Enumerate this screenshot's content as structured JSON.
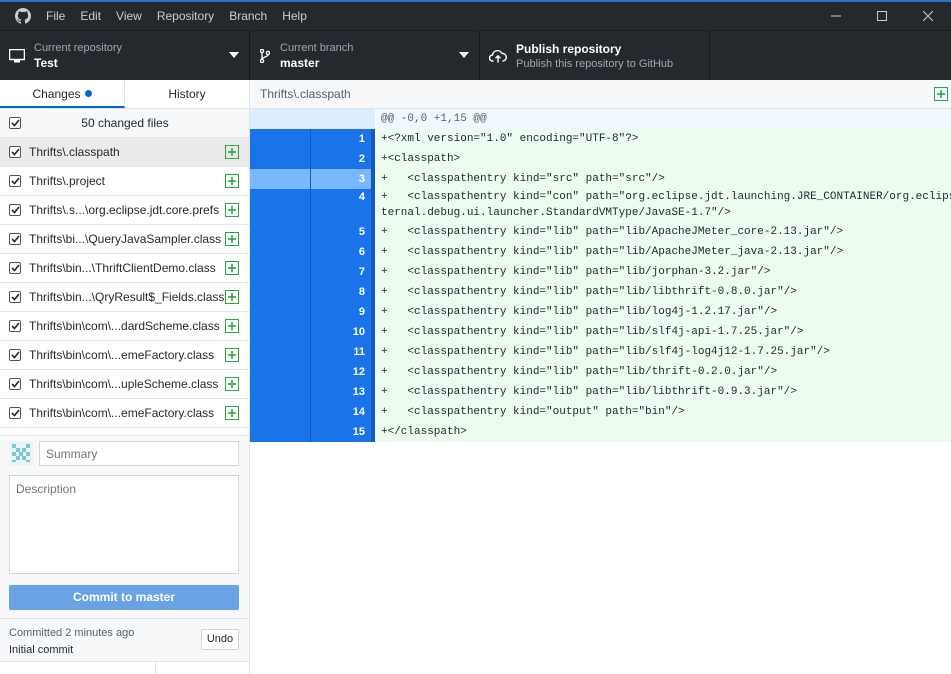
{
  "titlebar": {
    "menu": [
      "File",
      "Edit",
      "View",
      "Repository",
      "Branch",
      "Help"
    ]
  },
  "toolbar": {
    "repo_label": "Current repository",
    "repo_value": "Test",
    "branch_label": "Current branch",
    "branch_value": "master",
    "publish_title": "Publish repository",
    "publish_subtitle": "Publish this repository to GitHub"
  },
  "sidebar": {
    "tabs": [
      "Changes",
      "History"
    ],
    "changed_files_label": "50 changed files",
    "files": [
      "Thrifts\\.classpath",
      "Thrifts\\.project",
      "Thrifts\\.s...\\org.eclipse.jdt.core.prefs",
      "Thrifts\\bi...\\QueryJavaSampler.class",
      "Thrifts\\bin...\\ThriftClientDemo.class",
      "Thrifts\\bin...\\QryResult$_Fields.class",
      "Thrifts\\bin\\com\\...dardScheme.class",
      "Thrifts\\bin\\com\\...emeFactory.class",
      "Thrifts\\bin\\com\\...upleScheme.class",
      "Thrifts\\bin\\com\\...emeFactory.class"
    ],
    "summary_placeholder": "Summary",
    "description_placeholder": "Description",
    "commit_button": "Commit to master",
    "last_commit_time": "Committed 2 minutes ago",
    "last_commit_message": "Initial commit",
    "undo_button": "Undo"
  },
  "diff": {
    "path": "Thrifts\\.classpath",
    "hunk_header": "@@ -0,0 +1,15 @@",
    "lines": [
      {
        "n": "1",
        "text": "+<?xml version=\"1.0\" encoding=\"UTF-8\"?>"
      },
      {
        "n": "2",
        "text": "+<classpath>"
      },
      {
        "n": "3",
        "text": "+"
      },
      {
        "n": "4",
        "text": "+   <classpathentry kind=\"con\" path=\"org.eclipse.jdt.launching.JRE_CONTAINER/org.eclipse.jdt.in"
      },
      {
        "n": "",
        "text": "ternal.debug.ui.launcher.StandardVMType/JavaSE-1.7\"/>"
      },
      {
        "n": "5",
        "text": "+   <classpathentry kind=\"lib\" path=\"lib/ApacheJMeter_core-2.13.jar\"/>"
      },
      {
        "n": "6",
        "text": "+   <classpathentry kind=\"lib\" path=\"lib/ApacheJMeter_java-2.13.jar\"/>"
      },
      {
        "n": "7",
        "text": "+   <classpathentry kind=\"lib\" path=\"lib/jorphan-3.2.jar\"/>"
      },
      {
        "n": "8",
        "text": "+   <classpathentry kind=\"lib\" path=\"lib/libthrift-0.8.0.jar\"/>"
      },
      {
        "n": "9",
        "text": "+   <classpathentry kind=\"lib\" path=\"lib/log4j-1.2.17.jar\"/>"
      },
      {
        "n": "10",
        "text": "+   <classpathentry kind=\"lib\" path=\"lib/slf4j-api-1.7.25.jar\"/>"
      },
      {
        "n": "11",
        "text": "+   <classpathentry kind=\"lib\" path=\"lib/slf4j-log4j12-1.7.25.jar\"/>"
      },
      {
        "n": "12",
        "text": "+   <classpathentry kind=\"lib\" path=\"lib/thrift-0.2.0.jar\"/>"
      },
      {
        "n": "13",
        "text": "+   <classpathentry kind=\"lib\" path=\"lib/libthrift-0.9.3.jar\"/>"
      },
      {
        "n": "14",
        "text": "+   <classpathentry kind=\"output\" path=\"bin\"/>"
      },
      {
        "n": "15",
        "text": "+</classpath>"
      }
    ],
    "line2_extra": "+   <classpathentry kind=\"src\" path=\"src\"/>"
  },
  "colors": {
    "titlebar": "#24292e",
    "accent": "#0366d6",
    "gutter": "#1a73e8",
    "added_bg": "#ecfdf0",
    "commit_button": "#6aa2e6"
  }
}
